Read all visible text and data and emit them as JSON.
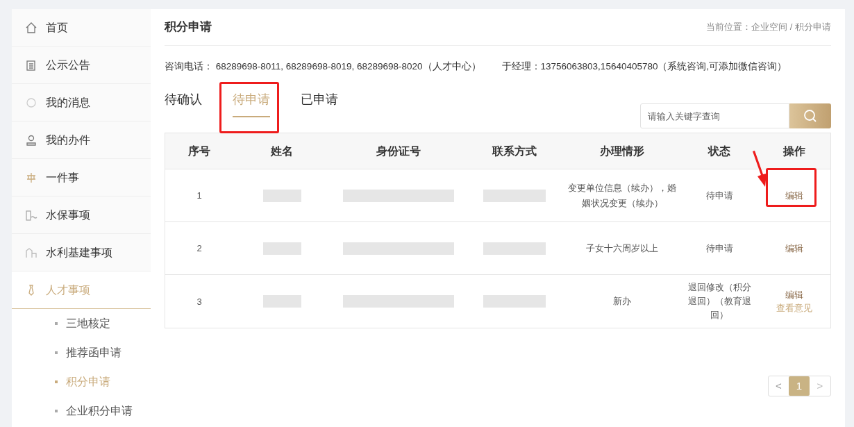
{
  "sidebar": {
    "items": [
      {
        "label": "首页",
        "selected": false
      },
      {
        "label": "公示公告",
        "selected": false
      },
      {
        "label": "我的消息",
        "selected": false
      },
      {
        "label": "我的办件",
        "selected": false
      },
      {
        "label": "一件事",
        "selected": false
      },
      {
        "label": "水保事项",
        "selected": false
      },
      {
        "label": "水利基建事项",
        "selected": false
      },
      {
        "label": "人才事项",
        "selected": true,
        "expanded": true,
        "children": [
          {
            "label": "三地核定",
            "selected": false
          },
          {
            "label": "推荐函申请",
            "selected": false
          },
          {
            "label": "积分申请",
            "selected": true
          },
          {
            "label": "企业积分申请",
            "selected": false
          }
        ]
      }
    ]
  },
  "page": {
    "title": "积分申请",
    "breadcrumb_label": "当前位置：",
    "breadcrumb": "企业空间 / 积分申请"
  },
  "contacts": [
    "咨询电话： 68289698-8011, 68289698-8019, 68289698-8020（人才中心）",
    "于经理：13756063803,15640405780（系统咨询,可添加微信咨询）"
  ],
  "tabs": [
    {
      "label": "待确认",
      "selected": false
    },
    {
      "label": "待申请",
      "selected": true
    },
    {
      "label": "已申请",
      "selected": false
    }
  ],
  "search": {
    "placeholder": "请输入关键字查询"
  },
  "table": {
    "columns": [
      "序号",
      "姓名",
      "身份证号",
      "联系方式",
      "办理情形",
      "状态",
      "操作"
    ],
    "rows": [
      {
        "index": "1",
        "situation": "变更单位信息（续办），婚姻状况变更（续办）",
        "status": "待申请",
        "actions": [
          {
            "label": "编辑",
            "kind": "primary"
          }
        ]
      },
      {
        "index": "2",
        "situation": "子女十六周岁以上",
        "status": "待申请",
        "actions": [
          {
            "label": "编辑",
            "kind": "primary"
          }
        ]
      },
      {
        "index": "3",
        "situation": "新办",
        "status": "退回修改（积分退回）（教育退回）",
        "actions": [
          {
            "label": "编辑",
            "kind": "primary"
          },
          {
            "label": "查看意见",
            "kind": "secondary"
          }
        ]
      }
    ]
  },
  "pagination": {
    "prev": "<",
    "pages": [
      {
        "label": "1",
        "selected": true
      }
    ],
    "next": ">"
  },
  "annotations": [
    {
      "kind": "tab-frame"
    },
    {
      "kind": "action-frame"
    },
    {
      "kind": "arrow"
    }
  ]
}
